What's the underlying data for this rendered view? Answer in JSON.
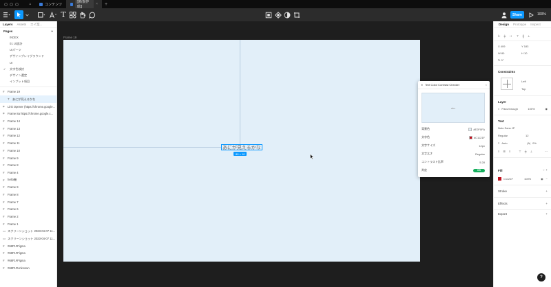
{
  "browser": {
    "tabs": [
      {
        "label": "コンテンツ"
      },
      {
        "label": "[[新規作成]]"
      }
    ]
  },
  "toolbar": {
    "share_label": "Share",
    "zoom_label": "100%"
  },
  "left_panel": {
    "tabs": [
      "Layers",
      "Assets",
      "エイ案..."
    ],
    "pages_title": "Pages",
    "pages": [
      {
        "label": "INDEX",
        "checked": false
      },
      {
        "label": "01 UI設計",
        "checked": false
      },
      {
        "label": "UIパーツ",
        "checked": false
      },
      {
        "label": "デザインプレイグラウンド",
        "checked": false
      },
      {
        "label": "UI",
        "checked": false
      },
      {
        "label": "文字色検討",
        "checked": true
      },
      {
        "label": "デザイン選定",
        "checked": false
      },
      {
        "label": "インプット項目",
        "checked": false
      }
    ],
    "layers": [
      {
        "label": "Frame 19",
        "icon": "#",
        "child": false
      },
      {
        "label": "あにが見えるかな",
        "icon": "T",
        "child": true
      },
      {
        "label": "Link Opener (https://chrome.google...",
        "icon": "⌗",
        "child": false
      },
      {
        "label": "Frame 8a https://chrome.google.c...",
        "icon": "⌗",
        "child": false
      },
      {
        "label": "Frame 14",
        "icon": "#",
        "child": false
      },
      {
        "label": "Frame 13",
        "icon": "#",
        "child": false
      },
      {
        "label": "Frame 12",
        "icon": "#",
        "child": false
      },
      {
        "label": "Frame 11",
        "icon": "#",
        "child": false
      },
      {
        "label": "Frame 10",
        "icon": "#",
        "child": false
      },
      {
        "label": "Frame 9",
        "icon": "#",
        "child": false
      },
      {
        "label": "Frame 8",
        "icon": "#",
        "child": false
      },
      {
        "label": "Frame 4",
        "icon": "#",
        "child": false
      },
      {
        "label": "hello機",
        "icon": "#",
        "child": false
      },
      {
        "label": "Frame 9",
        "icon": "#",
        "child": false
      },
      {
        "label": "Frame 8",
        "icon": "#",
        "child": false
      },
      {
        "label": "Frame 7",
        "icon": "#",
        "child": false
      },
      {
        "label": "Frame 6",
        "icon": "#",
        "child": false
      },
      {
        "label": "Frame 2",
        "icon": "#",
        "child": false
      },
      {
        "label": "Frame 1",
        "icon": "#",
        "child": false
      },
      {
        "label": "スクリーンショット 2023-04-07 11...",
        "icon": "▭",
        "child": false
      },
      {
        "label": "スクリーンショット 2023-04-07 11...",
        "icon": "▭",
        "child": false
      },
      {
        "label": "#68F1#Figma",
        "icon": "#",
        "child": false
      },
      {
        "label": "#68F1#Figma",
        "icon": "#",
        "child": false
      },
      {
        "label": "#68F1#Figma",
        "icon": "#",
        "child": false
      },
      {
        "label": "#68F1#Unknown",
        "icon": "#",
        "child": false
      }
    ]
  },
  "canvas": {
    "frame_label": "Frame 19",
    "selected_text": "あにが見えるかな",
    "size_badge": "80 × 10"
  },
  "plugin": {
    "title": "Text Color Contrast Checker",
    "preview_text": "abc",
    "rows": [
      {
        "label": "背景色",
        "value": "#E2F0FA",
        "swatch": "#e2f0fa"
      },
      {
        "label": "文字色",
        "value": "#C1121F",
        "swatch": "#c1121f"
      },
      {
        "label": "文字サイズ",
        "value": "12px",
        "swatch": ""
      },
      {
        "label": "文字太さ",
        "value": "Regular",
        "swatch": ""
      },
      {
        "label": "コントラスト比率",
        "value": "5.28",
        "swatch": ""
      }
    ],
    "verdict_label": "判定",
    "verdict_value": "OK"
  },
  "right_panel": {
    "tabs": [
      "Design",
      "Prototype",
      "Inspect"
    ],
    "coords": {
      "x": "X  409",
      "y": "Y  183",
      "w": "W  80",
      "h": "H  10",
      "rotation": "↻  0°"
    },
    "constraints_title": "Constraints",
    "constraints": {
      "h": "Left",
      "v": "Top"
    },
    "layer_title": "Layer",
    "layer_mode": "Pass through",
    "layer_opacity": "100%",
    "text_title": "Text",
    "font_family": "Noto Sans JP",
    "font_weight": "Regular",
    "font_size": "12",
    "line_height": "Auto",
    "letter_spacing": "0%",
    "fill_title": "Fill",
    "fill_hex": "C1121F",
    "fill_opacity": "100%",
    "stroke_title": "Stroke",
    "effects_title": "Effects",
    "export_title": "Export"
  },
  "help_label": "?"
}
